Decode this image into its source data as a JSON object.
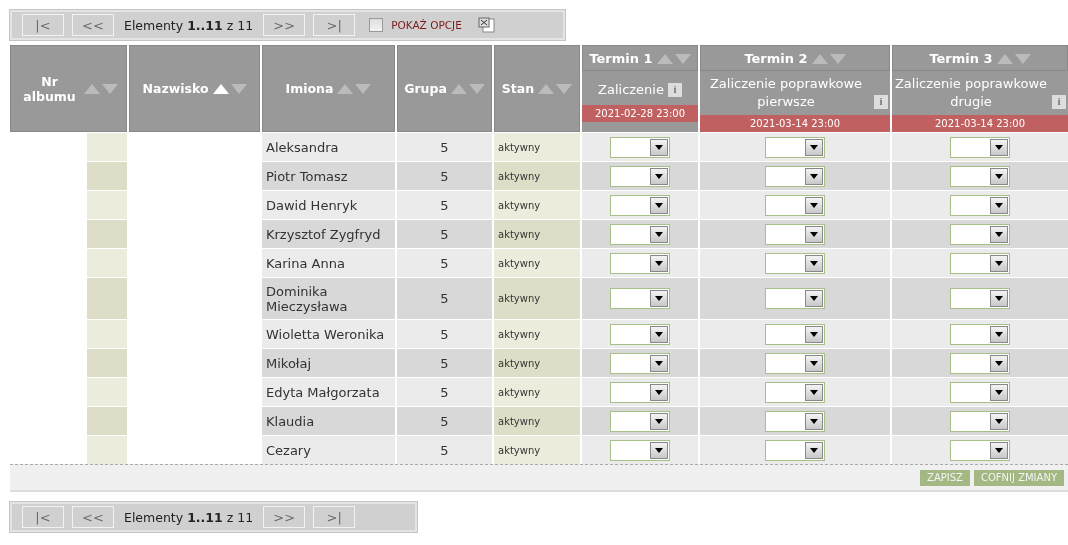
{
  "pager_top": {
    "buttons": [
      {
        "label": "|<",
        "disabled": true
      },
      {
        "label": "<<",
        "disabled": true
      }
    ],
    "summary": "Elementy **1..11** z 11",
    "buttons_after": [
      {
        "label": ">>",
        "disabled": true
      },
      {
        "label": ">|",
        "disabled": true
      }
    ],
    "options": {
      "label": "POKAŻ OPCJE",
      "checked": false
    }
  },
  "columns": [
    {
      "label": "Nr albumu",
      "sorted": false
    },
    {
      "label": "Nazwisko",
      "sorted": true
    },
    {
      "label": "Imiona",
      "sorted": false
    },
    {
      "label": "Grupa",
      "sorted": false
    },
    {
      "label": "Stan",
      "sorted": false
    }
  ],
  "terms": [
    {
      "label": "Termin 1",
      "sorted": false,
      "name": "Zaliczenie",
      "info": "i",
      "date": "2021-02-28 23:00"
    },
    {
      "label": "Termin 2",
      "sorted": false,
      "name": "Zaliczenie poprawkowe pierwsze",
      "info": "i",
      "date": "2021-03-14 23:00"
    },
    {
      "label": "Termin 3",
      "sorted": false,
      "name": "Zaliczenie poprawkowe drugie",
      "info": "i",
      "date": "2021-03-14 23:00"
    }
  ],
  "rows": [
    {
      "first_names": "Aleksandra",
      "group": "5",
      "status": "aktywny"
    },
    {
      "first_names": "Piotr Tomasz",
      "group": "5",
      "status": "aktywny"
    },
    {
      "first_names": "Dawid Henryk",
      "group": "5",
      "status": "aktywny"
    },
    {
      "first_names": "Krzysztof Zygfryd",
      "group": "5",
      "status": "aktywny"
    },
    {
      "first_names": "Karina Anna",
      "group": "5",
      "status": "aktywny"
    },
    {
      "first_names": "Dominika Mieczysława",
      "group": "5",
      "status": "aktywny"
    },
    {
      "first_names": "Wioletta Weronika",
      "group": "5",
      "status": "aktywny"
    },
    {
      "first_names": "Mikołaj",
      "group": "5",
      "status": "aktywny"
    },
    {
      "first_names": "Edyta Małgorzata",
      "group": "5",
      "status": "aktywny"
    },
    {
      "first_names": "Klaudia",
      "group": "5",
      "status": "aktywny"
    },
    {
      "first_names": "Cezary",
      "group": "5",
      "status": "aktywny"
    }
  ],
  "actions": [
    "ZAPISZ",
    "COFNIJ ZMIANY"
  ],
  "pager_bottom": {
    "buttons": [
      {
        "label": "|<",
        "disabled": true
      },
      {
        "label": "<<",
        "disabled": true
      }
    ],
    "summary": "Elementy **1..11** z 11",
    "buttons_after": [
      {
        "label": ">>",
        "disabled": true
      },
      {
        "label": ">|",
        "disabled": true
      }
    ]
  }
}
